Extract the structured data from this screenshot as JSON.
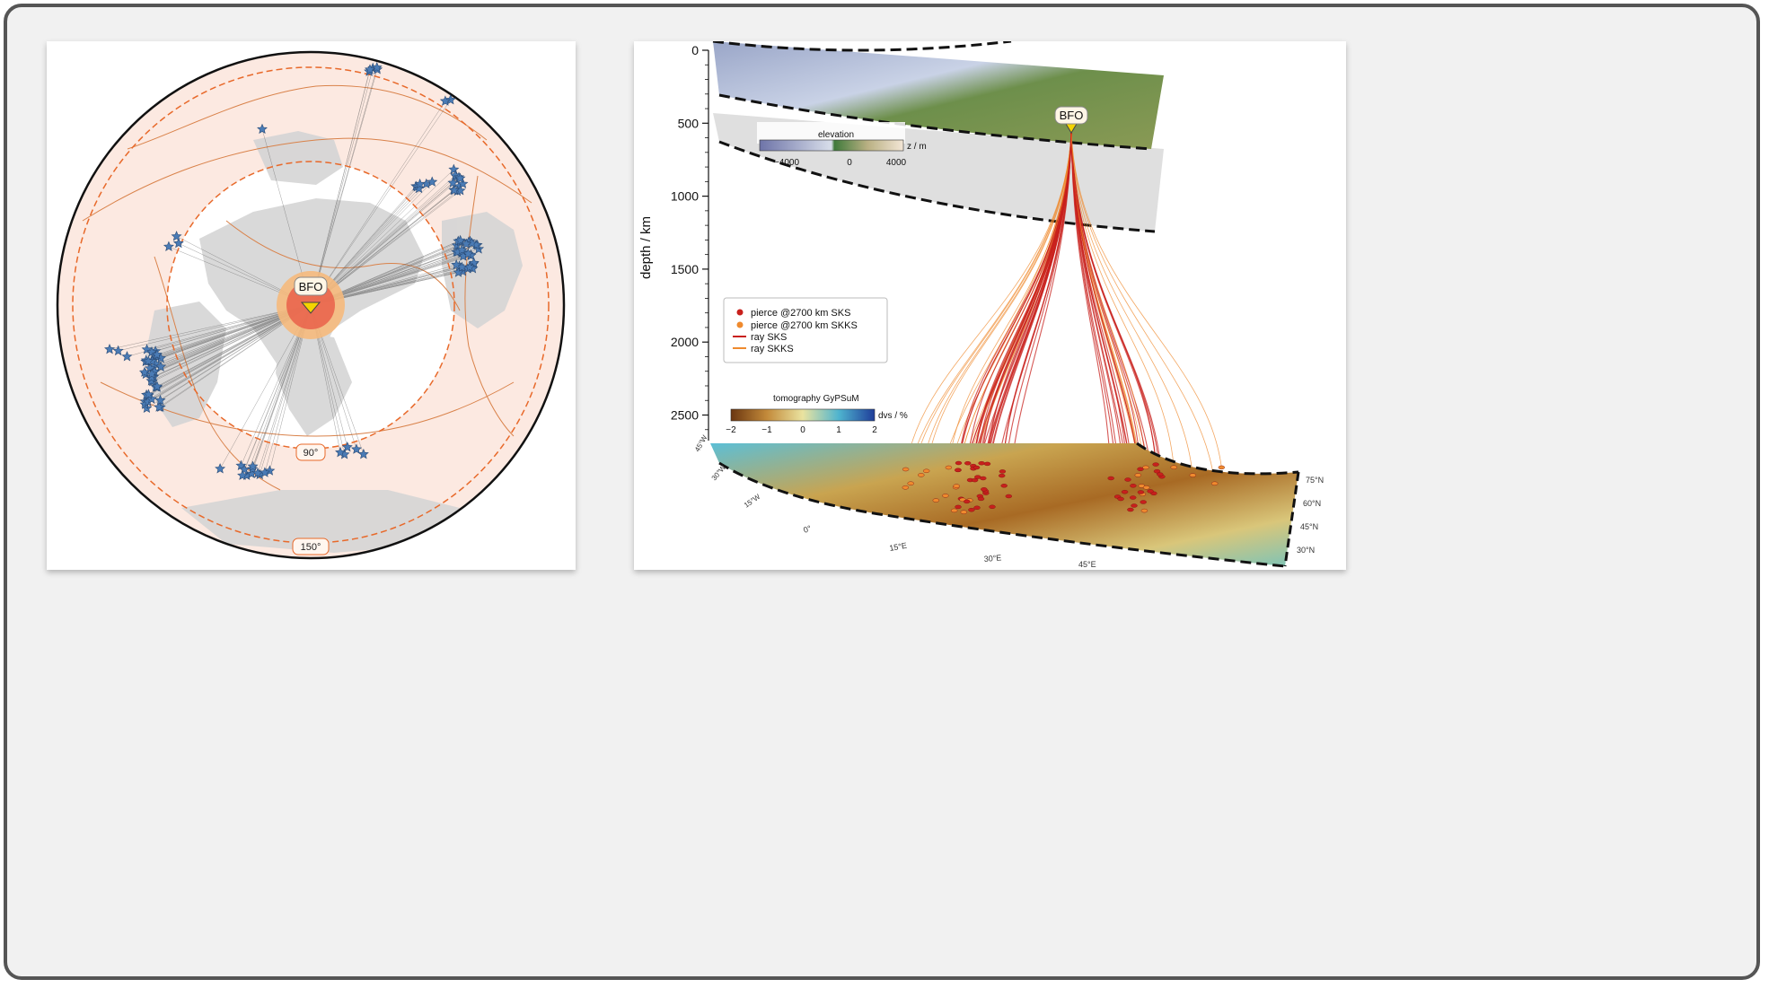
{
  "left_map": {
    "station_label": "BFO",
    "distance_labels": [
      "90°",
      "150°"
    ]
  },
  "right_figure": {
    "y_axis": {
      "label": "depth / km",
      "ticks": [
        "0",
        "500",
        "1000",
        "1500",
        "2000",
        "2500"
      ]
    },
    "station_label": "BFO",
    "elevation_colorbar": {
      "title": "elevation",
      "unit": "z / m",
      "ticks": [
        "−4000",
        "0",
        "4000"
      ]
    },
    "tomography_colorbar": {
      "title": "tomography GyPSuM",
      "unit": "dvs / %",
      "ticks": [
        "−2",
        "−1",
        "0",
        "1",
        "2"
      ]
    },
    "legend": {
      "items": [
        {
          "label": "pierce @2700 km SKS",
          "color": "#c8201c",
          "kind": "dot"
        },
        {
          "label": "pierce @2700 km SKKS",
          "color": "#ef8a2e",
          "kind": "dot"
        },
        {
          "label": "ray SKS",
          "color": "#c8201c",
          "kind": "line"
        },
        {
          "label": "ray SKKS",
          "color": "#ef8a2e",
          "kind": "line"
        }
      ]
    },
    "lat_labels": [
      "75°N",
      "60°N",
      "45°N",
      "30°N"
    ],
    "lon_labels": [
      "45°W",
      "30°W",
      "15°W",
      "0°",
      "15°E",
      "30°E",
      "45°E"
    ]
  },
  "colors": {
    "sks": "#c8201c",
    "skks": "#ef8a2e",
    "event_star": "#4a7bb5",
    "distance_ring": "#e8692a",
    "plate_boundary": "#d9824a"
  }
}
